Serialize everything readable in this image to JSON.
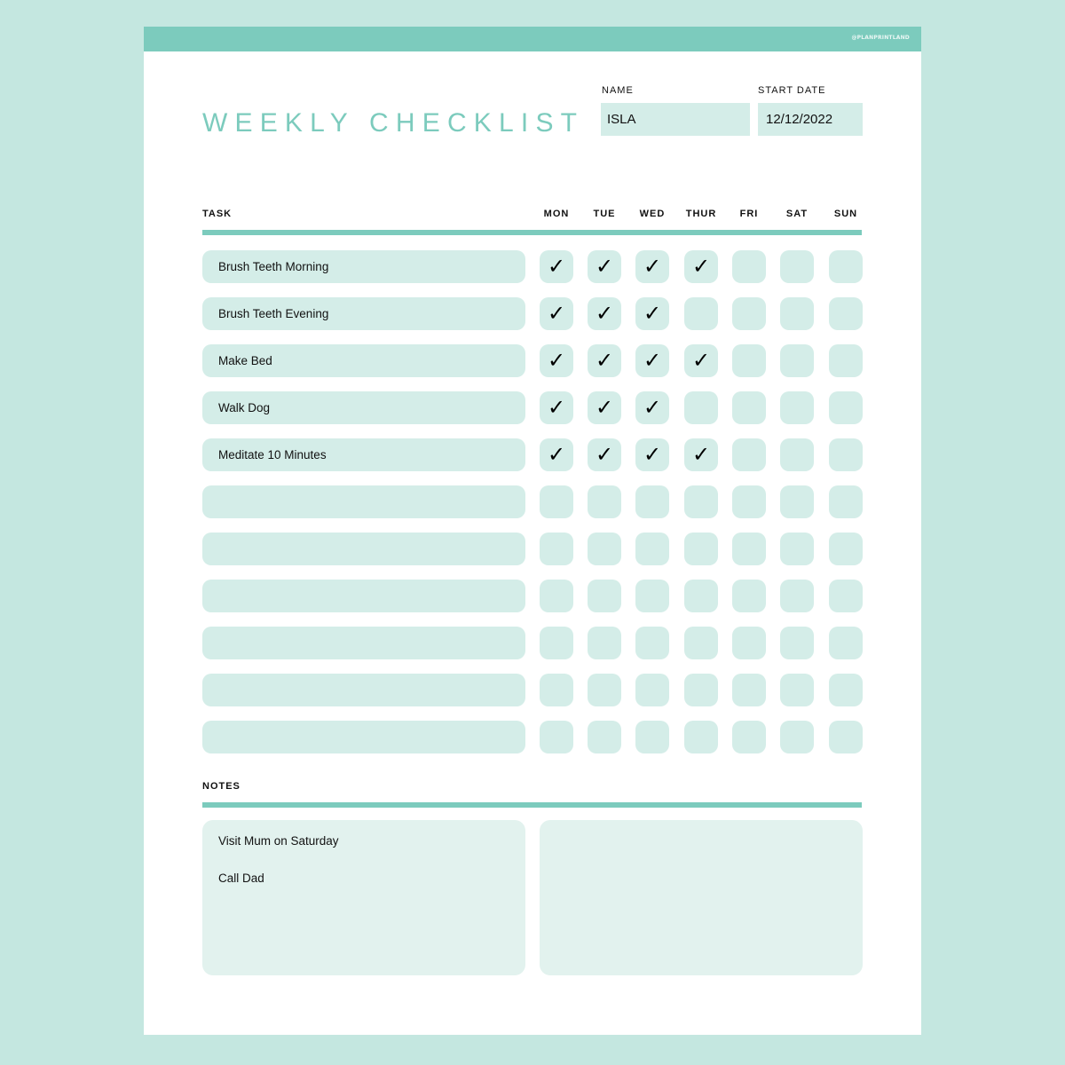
{
  "header": {
    "brand": "@PLANPRINTLAND",
    "title": "WEEKLY CHECKLIST"
  },
  "fields": {
    "name_label": "NAME",
    "name_value": "ISLA",
    "start_date_label": "START DATE",
    "start_date_value": "12/12/2022"
  },
  "table": {
    "task_header": "TASK",
    "days": [
      "MON",
      "TUE",
      "WED",
      "THUR",
      "FRI",
      "SAT",
      "SUN"
    ],
    "check_glyph": "✓",
    "rows": [
      {
        "task": "Brush Teeth Morning",
        "checks": [
          true,
          true,
          true,
          true,
          false,
          false,
          false
        ]
      },
      {
        "task": "Brush Teeth Evening",
        "checks": [
          true,
          true,
          true,
          false,
          false,
          false,
          false
        ]
      },
      {
        "task": "Make Bed",
        "checks": [
          true,
          true,
          true,
          true,
          false,
          false,
          false
        ]
      },
      {
        "task": "Walk Dog",
        "checks": [
          true,
          true,
          true,
          false,
          false,
          false,
          false
        ]
      },
      {
        "task": "Meditate 10 Minutes",
        "checks": [
          true,
          true,
          true,
          true,
          false,
          false,
          false
        ]
      },
      {
        "task": "",
        "checks": [
          false,
          false,
          false,
          false,
          false,
          false,
          false
        ]
      },
      {
        "task": "",
        "checks": [
          false,
          false,
          false,
          false,
          false,
          false,
          false
        ]
      },
      {
        "task": "",
        "checks": [
          false,
          false,
          false,
          false,
          false,
          false,
          false
        ]
      },
      {
        "task": "",
        "checks": [
          false,
          false,
          false,
          false,
          false,
          false,
          false
        ]
      },
      {
        "task": "",
        "checks": [
          false,
          false,
          false,
          false,
          false,
          false,
          false
        ]
      },
      {
        "task": "",
        "checks": [
          false,
          false,
          false,
          false,
          false,
          false,
          false
        ]
      }
    ]
  },
  "notes": {
    "label": "NOTES",
    "left": [
      "Visit Mum on Saturday",
      "Call Dad"
    ],
    "right": []
  },
  "colors": {
    "accent": "#7ccbbd",
    "background": "#c4e7e0",
    "cell_fill": "#d4ede8",
    "notes_fill": "#e2f2ee"
  }
}
